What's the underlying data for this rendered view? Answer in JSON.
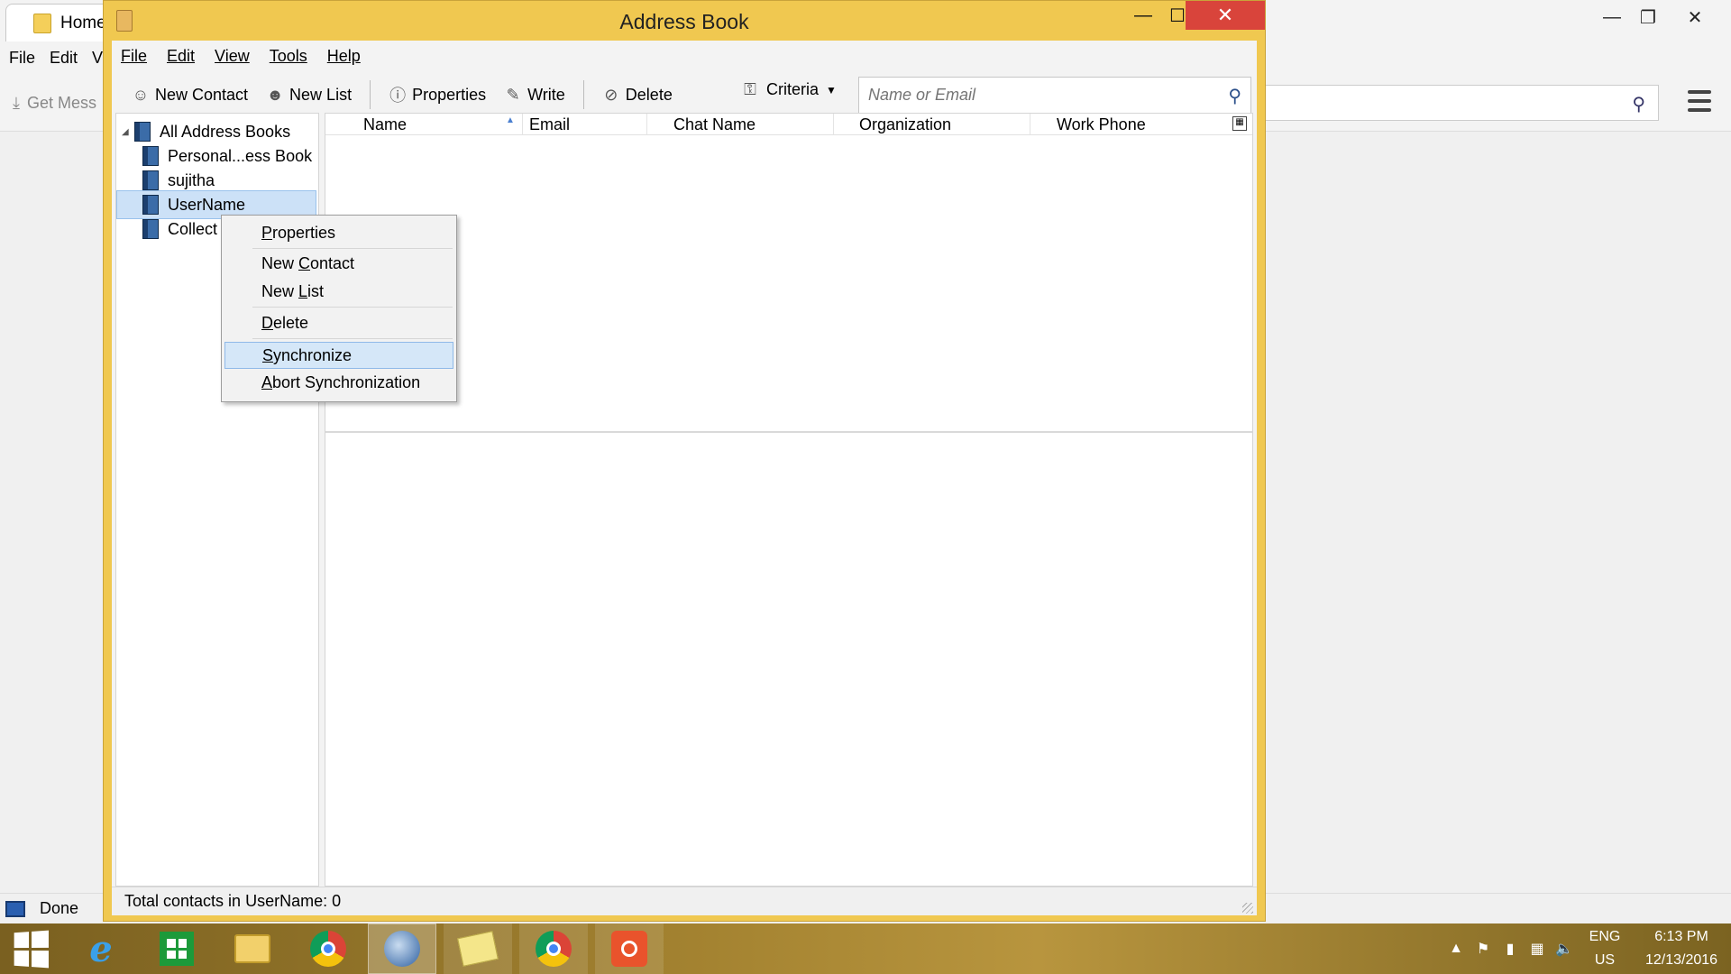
{
  "background_window": {
    "tab_label": "Home",
    "menu": [
      "File",
      "Edit",
      "Vi"
    ],
    "get_messages_label": "Get Mess",
    "status_text": "Done"
  },
  "dialog": {
    "title": "Address Book",
    "menu": [
      "File",
      "Edit",
      "View",
      "Tools",
      "Help"
    ],
    "toolbar": {
      "new_contact": "New Contact",
      "new_list": "New List",
      "properties": "Properties",
      "write": "Write",
      "delete": "Delete",
      "criteria": "Criteria"
    },
    "search": {
      "placeholder": "Name or Email"
    },
    "tree": [
      {
        "label": "All Address Books",
        "level": 0,
        "selected": false
      },
      {
        "label": "Personal...ess Book",
        "level": 1,
        "selected": false
      },
      {
        "label": "sujitha",
        "level": 1,
        "selected": false
      },
      {
        "label": "UserName",
        "level": 1,
        "selected": true
      },
      {
        "label": "Collect",
        "level": 1,
        "selected": false
      }
    ],
    "columns": [
      "Name",
      "Email",
      "Chat Name",
      "Organization",
      "Work Phone"
    ],
    "status": "Total contacts in UserName: 0"
  },
  "context_menu": {
    "items": [
      {
        "label": "Properties",
        "accel_index": 0,
        "highlighted": false
      },
      {
        "label": "New Contact",
        "accel_index": 4,
        "highlighted": false
      },
      {
        "label": "New List",
        "accel_index": 4,
        "highlighted": false
      },
      {
        "label": "Delete",
        "accel_index": 0,
        "highlighted": false
      },
      {
        "label": "Synchronize",
        "accel_index": 0,
        "highlighted": true
      },
      {
        "label": "Abort Synchronization",
        "accel_index": 0,
        "highlighted": false
      }
    ]
  },
  "taskbar": {
    "lang_top": "ENG",
    "lang_bottom": "US",
    "time": "6:13 PM",
    "date": "12/13/2016"
  },
  "colors": {
    "dialog_frame": "#f0c850",
    "close_button": "#d9443b",
    "selection": "#cce1f7",
    "menu_highlight": "#d5e7f8"
  }
}
